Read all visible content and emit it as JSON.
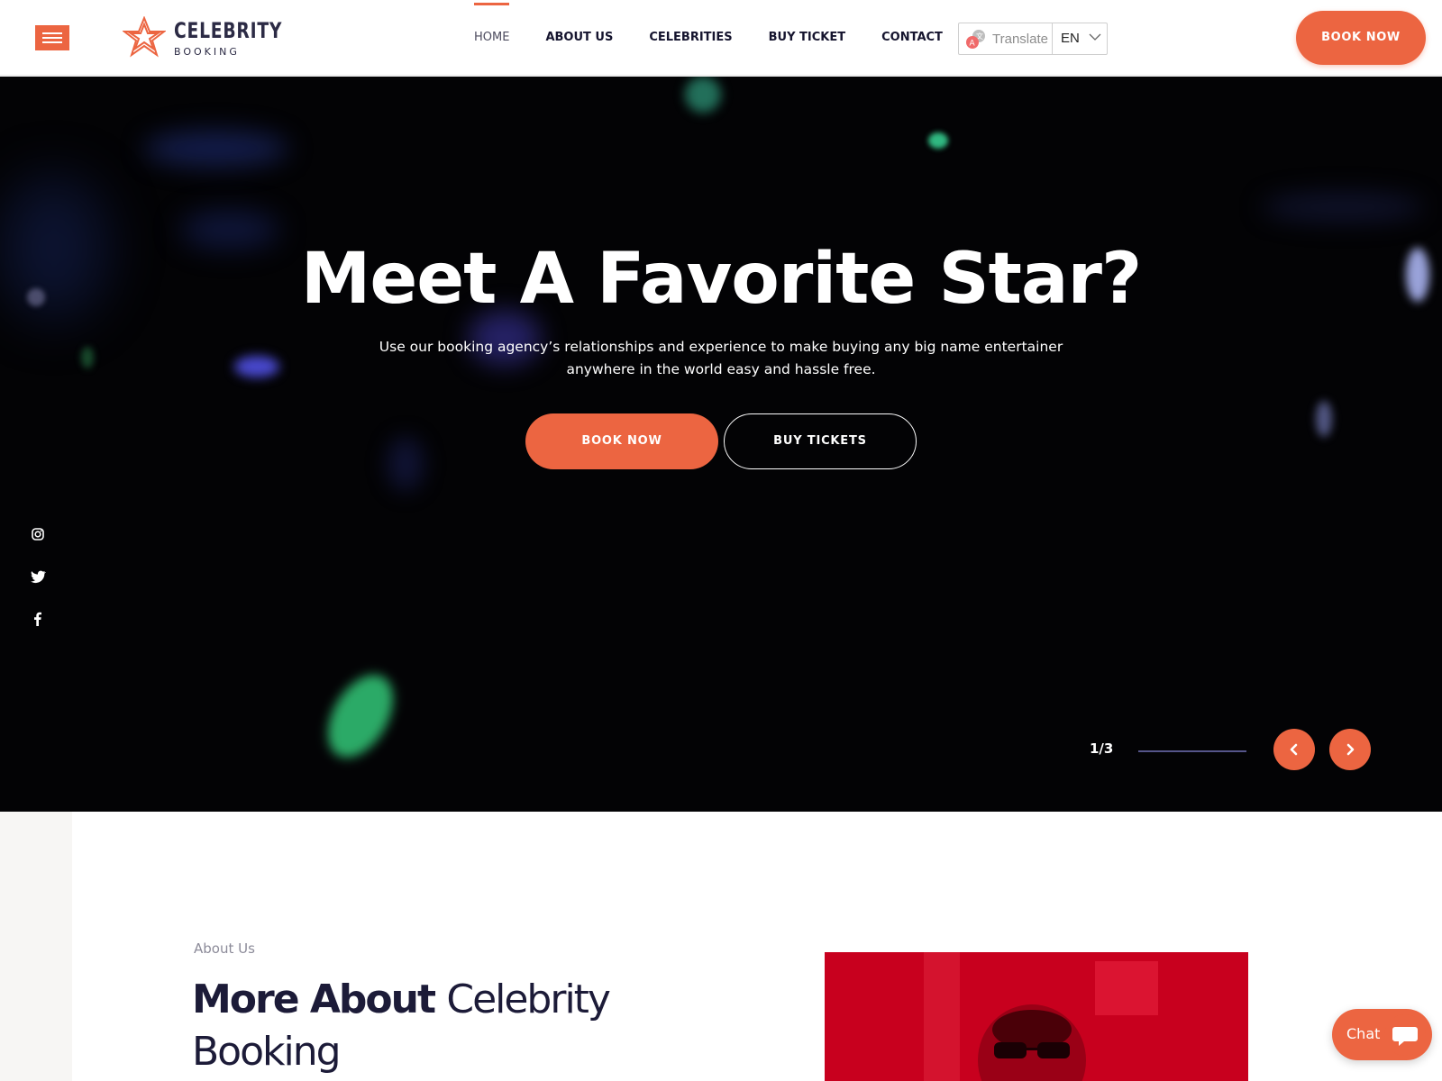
{
  "header": {
    "logo": {
      "title": "CELEBRITY",
      "subtitle": "BOOKING"
    },
    "nav": [
      {
        "label": "HOME",
        "active": true
      },
      {
        "label": "ABOUT US",
        "active": false
      },
      {
        "label": "CELEBRITIES",
        "active": false
      },
      {
        "label": "BUY TICKET",
        "active": false
      },
      {
        "label": "CONTACT",
        "active": false
      }
    ],
    "translate": {
      "label": "Translate",
      "language": "EN"
    },
    "book_button": "BOOK NOW"
  },
  "hero": {
    "title": "Meet A Favorite Star?",
    "subtitle": "Use our booking agency’s relationships and experience to make buying any big name entertainer anywhere in the world easy and hassle free.",
    "primary_button": "BOOK NOW",
    "secondary_button": "BUY TICKETS",
    "slider": {
      "counter": "1/3",
      "current": 1,
      "total": 3
    },
    "social": [
      "instagram-icon",
      "twitter-icon",
      "facebook-icon"
    ]
  },
  "about": {
    "eyebrow": "About Us",
    "heading_bold": "More About",
    "heading_light": "Celebrity Booking"
  },
  "chat": {
    "label": "Chat"
  },
  "colors": {
    "accent": "#ec6541",
    "dark": "#1c1b38",
    "hero_bg": "#030305"
  }
}
